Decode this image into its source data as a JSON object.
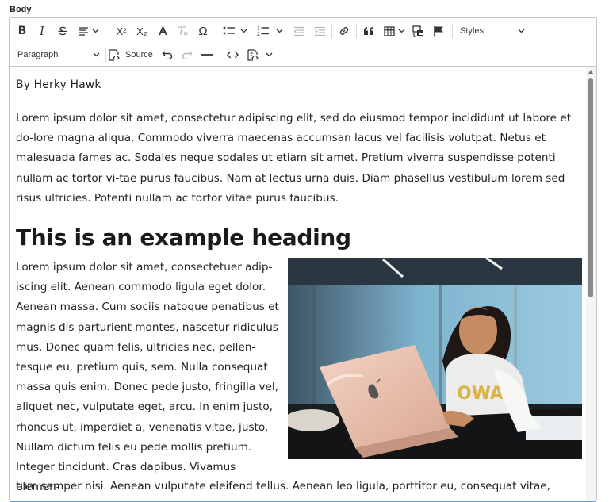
{
  "field": {
    "label": "Body"
  },
  "toolbar": {
    "bold": "B",
    "italic": "I",
    "superscript": "X²",
    "subscript": "X₂",
    "styles_label": "Styles",
    "paragraph_label": "Paragraph",
    "source_label": "Source"
  },
  "document": {
    "byline": "By Herky Hawk",
    "paragraph1": "Lorem ipsum dolor sit amet, consectetur adipiscing elit, sed do eiusmod tempor incididunt ut labore et do-lore magna aliqua. Commodo viverra maecenas accumsan lacus vel facilisis volutpat. Netus et malesuada fames ac. Sodales neque sodales ut etiam sit amet. Pretium viverra suspendisse potenti nullam ac tortor vi-tae purus faucibus. Nam at lectus urna duis. Diam phasellus vestibulum lorem sed risus ultricies. Potenti nullam ac tortor vitae purus faucibus.",
    "heading": "This is an example heading",
    "paragraph2": "Lorem ipsum dolor sit amet, consectetuer adip-iscing elit. Aenean commodo ligula eget dolor. Aenean massa. Cum sociis natoque penatibus et magnis dis parturient montes, nascetur ridiculus mus. Donec quam felis, ultricies nec, pellen-tesque eu, pretium quis, sem. Nulla consequat massa quis enim. Donec pede justo, fringilla vel, aliquet nec, vulputate eget, arcu. In enim justo, rhoncus ut, imperdiet a, venenatis vitae, justo. Nullam dictum felis eu pede mollis pretium. Integer tincidunt. Cras dapibus. Vivamus elemen-",
    "paragraph2_tail": "tum semper nisi. Aenean vulputate eleifend tellus. Aenean leo ligula, porttitor eu, consequat vitae, eleifend",
    "photo_shirt_text": "OWA"
  },
  "colors": {
    "focus_border": "#6a9be0",
    "border": "#c4c4c4",
    "icon": "#333333",
    "icon_disabled": "#b9b9b9"
  },
  "icons": [
    "bold-icon",
    "italic-icon",
    "strikethrough-icon",
    "align-icon",
    "superscript-icon",
    "subscript-icon",
    "text-color-icon",
    "remove-format-icon",
    "special-characters-icon",
    "bulleted-list-icon",
    "numbered-list-icon",
    "outdent-icon",
    "indent-icon",
    "link-icon",
    "blockquote-icon",
    "table-icon",
    "media-embed-icon",
    "flag-icon",
    "undo-icon",
    "redo-icon",
    "horizontal-line-icon",
    "code-icon",
    "show-blocks-icon",
    "source-icon"
  ]
}
